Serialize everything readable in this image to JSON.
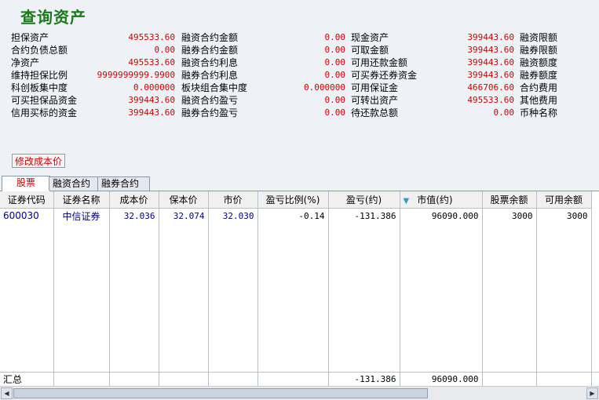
{
  "title": "查询资产",
  "summary_grid": {
    "col1": [
      {
        "label": "担保资产",
        "value": "495533.60"
      },
      {
        "label": "合约负债总额",
        "value": "0.00"
      },
      {
        "label": "净资产",
        "value": "495533.60"
      },
      {
        "label": "维持担保比例",
        "value": "9999999999.9900"
      },
      {
        "label": "科创板集中度",
        "value": "0.000000"
      },
      {
        "label": "可买担保品资金",
        "value": "399443.60"
      },
      {
        "label": "信用买标的资金",
        "value": "399443.60"
      }
    ],
    "col2": [
      {
        "label": "融资合约金额",
        "value": "0.00"
      },
      {
        "label": "融券合约金额",
        "value": "0.00"
      },
      {
        "label": "融资合约利息",
        "value": "0.00"
      },
      {
        "label": "融券合约利息",
        "value": "0.00"
      },
      {
        "label": "板块组合集中度",
        "value": "0.000000"
      },
      {
        "label": "融资合约盈亏",
        "value": "0.00"
      },
      {
        "label": "融券合约盈亏",
        "value": "0.00"
      }
    ],
    "col3": [
      {
        "label": "现金资产",
        "value": "399443.60"
      },
      {
        "label": "可取金额",
        "value": "399443.60"
      },
      {
        "label": "可用还款金额",
        "value": "399443.60"
      },
      {
        "label": "可买券还券资金",
        "value": "399443.60"
      },
      {
        "label": "可用保证金",
        "value": "466706.60"
      },
      {
        "label": "可转出资产",
        "value": "495533.60"
      },
      {
        "label": "待还款总额",
        "value": "0.00"
      }
    ],
    "col4": [
      {
        "label": "融资限额"
      },
      {
        "label": "融券限额"
      },
      {
        "label": "融资额度"
      },
      {
        "label": "融券额度"
      },
      {
        "label": "合约费用"
      },
      {
        "label": "其他费用"
      },
      {
        "label": "币种名称"
      }
    ]
  },
  "modify_cost_button": "修改成本价",
  "tabs": [
    "股票",
    "融资合约",
    "融券合约"
  ],
  "table": {
    "headers": [
      "证券代码",
      "证券名称",
      "成本价",
      "保本价",
      "市价",
      "盈亏比例(%)",
      "盈亏(约)",
      "市值(约)",
      "股票余额",
      "可用余额"
    ],
    "rows": [
      [
        "600030",
        "中信证券",
        "32.036",
        "32.074",
        "32.030",
        "-0.14",
        "-131.386",
        "96090.000",
        "3000",
        "3000"
      ]
    ],
    "summary": {
      "label": "汇总",
      "pnl": "-131.386",
      "market_value": "96090.000"
    }
  },
  "colors": {
    "accent_red": "#d00000",
    "title_green": "#1a7a1a",
    "code_blue": "#000080"
  }
}
